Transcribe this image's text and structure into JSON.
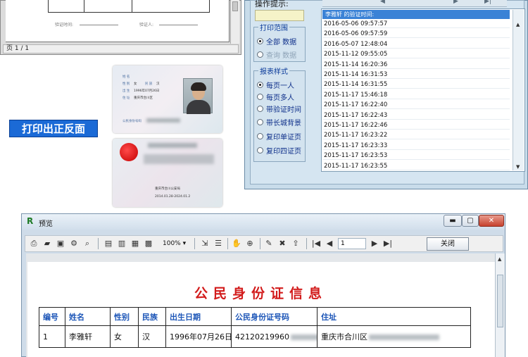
{
  "doc_preview": {
    "page_status": "页 1 / 1",
    "sig_left": "验证时间:",
    "sig_right": "验证人:"
  },
  "id_front": {
    "name_label": "姓 名",
    "sex_label": "性 别",
    "sex": "女",
    "nation_label": "民 族",
    "nation": "汉",
    "birth_label": "出 生",
    "birth": "1996年07月26日",
    "addr_label": "住 址",
    "addr_line1": "重庆市合川区",
    "id_label": "公民身份号码"
  },
  "id_back": {
    "authority": "重庆市合川公安局",
    "validity": "2014.01.28-2024.01.2"
  },
  "print_label": "打印出正反面",
  "dialog": {
    "op_hint": "操作提示:",
    "range_group": "打印范围",
    "range_all": "全部 数据",
    "range_query": "查询 数据",
    "style_group": "报表样式",
    "style_options": [
      "每页一人",
      "每页多人",
      "带验证时间",
      "带长城背景",
      "复印单证页",
      "复印四证页"
    ],
    "list_header": "李雅轩 的验证时间:",
    "timestamps": [
      "2016-05-06 09:57:57",
      "2016-05-06 09:57:59",
      "2016-05-07 12:48:04",
      "2015-11-12 09:55:05",
      "2015-11-14 16:20:36",
      "2015-11-14 16:31:53",
      "2015-11-14 16:31:55",
      "2015-11-17 15:46:18",
      "2015-11-17 16:22:40",
      "2015-11-17 16:22:43",
      "2015-11-17 16:22:46",
      "2015-11-17 16:23:22",
      "2015-11-17 16:23:33",
      "2015-11-17 16:23:53",
      "2015-11-17 16:23:55"
    ]
  },
  "preview": {
    "window_title": "预览",
    "zoom": "100%",
    "page_number": "1",
    "close_label": "关闭",
    "report_title": "公民身份证信息",
    "columns": [
      "编号",
      "姓名",
      "性别",
      "民族",
      "出生日期",
      "公民身份证号码",
      "住址"
    ],
    "row": {
      "no": "1",
      "name": "李雅轩",
      "sex": "女",
      "nation": "汉",
      "birth": "1996年07月26日",
      "id_no": "42120219960",
      "address": "重庆市合川区"
    }
  }
}
